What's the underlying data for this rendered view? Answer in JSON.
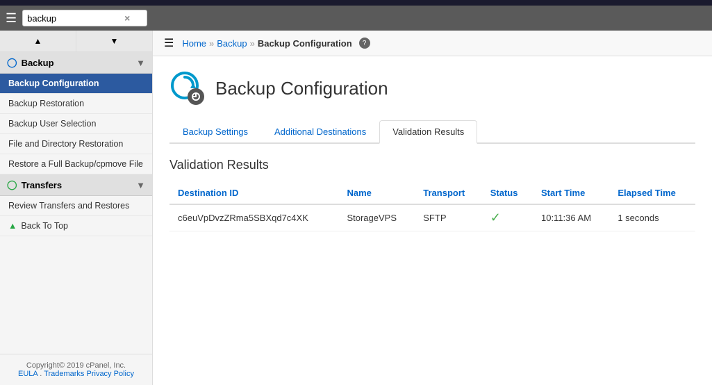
{
  "topBar": {},
  "searchArea": {
    "inputValue": "backup",
    "inputPlaceholder": "backup",
    "clearLabel": "×"
  },
  "breadcrumb": {
    "home": "Home",
    "backup": "Backup",
    "current": "Backup Configuration",
    "separator": "»"
  },
  "pageHeader": {
    "title": "Backup Configuration"
  },
  "tabs": [
    {
      "label": "Backup Settings",
      "id": "backup-settings",
      "active": false
    },
    {
      "label": "Additional Destinations",
      "id": "additional-destinations",
      "active": false
    },
    {
      "label": "Validation Results",
      "id": "validation-results",
      "active": true
    }
  ],
  "sectionTitle": "Validation Results",
  "tableHeaders": [
    {
      "label": "Destination ID"
    },
    {
      "label": "Name"
    },
    {
      "label": "Transport"
    },
    {
      "label": "Status"
    },
    {
      "label": "Start Time"
    },
    {
      "label": "Elapsed Time"
    }
  ],
  "tableRows": [
    {
      "destinationId": "c6euVpDvzZRma5SBXqd7c4XK",
      "name": "StorageVPS",
      "transport": "SFTP",
      "status": "success",
      "startTime": "10:11:36 AM",
      "elapsedTime": "1 seconds"
    }
  ],
  "sidebar": {
    "groups": [
      {
        "id": "backup",
        "label": "Backup",
        "items": [
          {
            "label": "Backup Configuration",
            "active": true
          },
          {
            "label": "Backup Restoration",
            "active": false
          },
          {
            "label": "Backup User Selection",
            "active": false
          },
          {
            "label": "File and Directory Restoration",
            "active": false
          },
          {
            "label": "Restore a Full Backup/cpmove File",
            "active": false
          }
        ]
      },
      {
        "id": "transfers",
        "label": "Transfers",
        "items": [
          {
            "label": "Review Transfers and Restores",
            "active": false
          }
        ]
      }
    ],
    "backToTop": "Back To Top",
    "footer": {
      "copyright": "Copyright© 2019 cPanel, Inc.",
      "links": [
        "EULA",
        "Trademarks",
        "Privacy Policy"
      ]
    }
  }
}
